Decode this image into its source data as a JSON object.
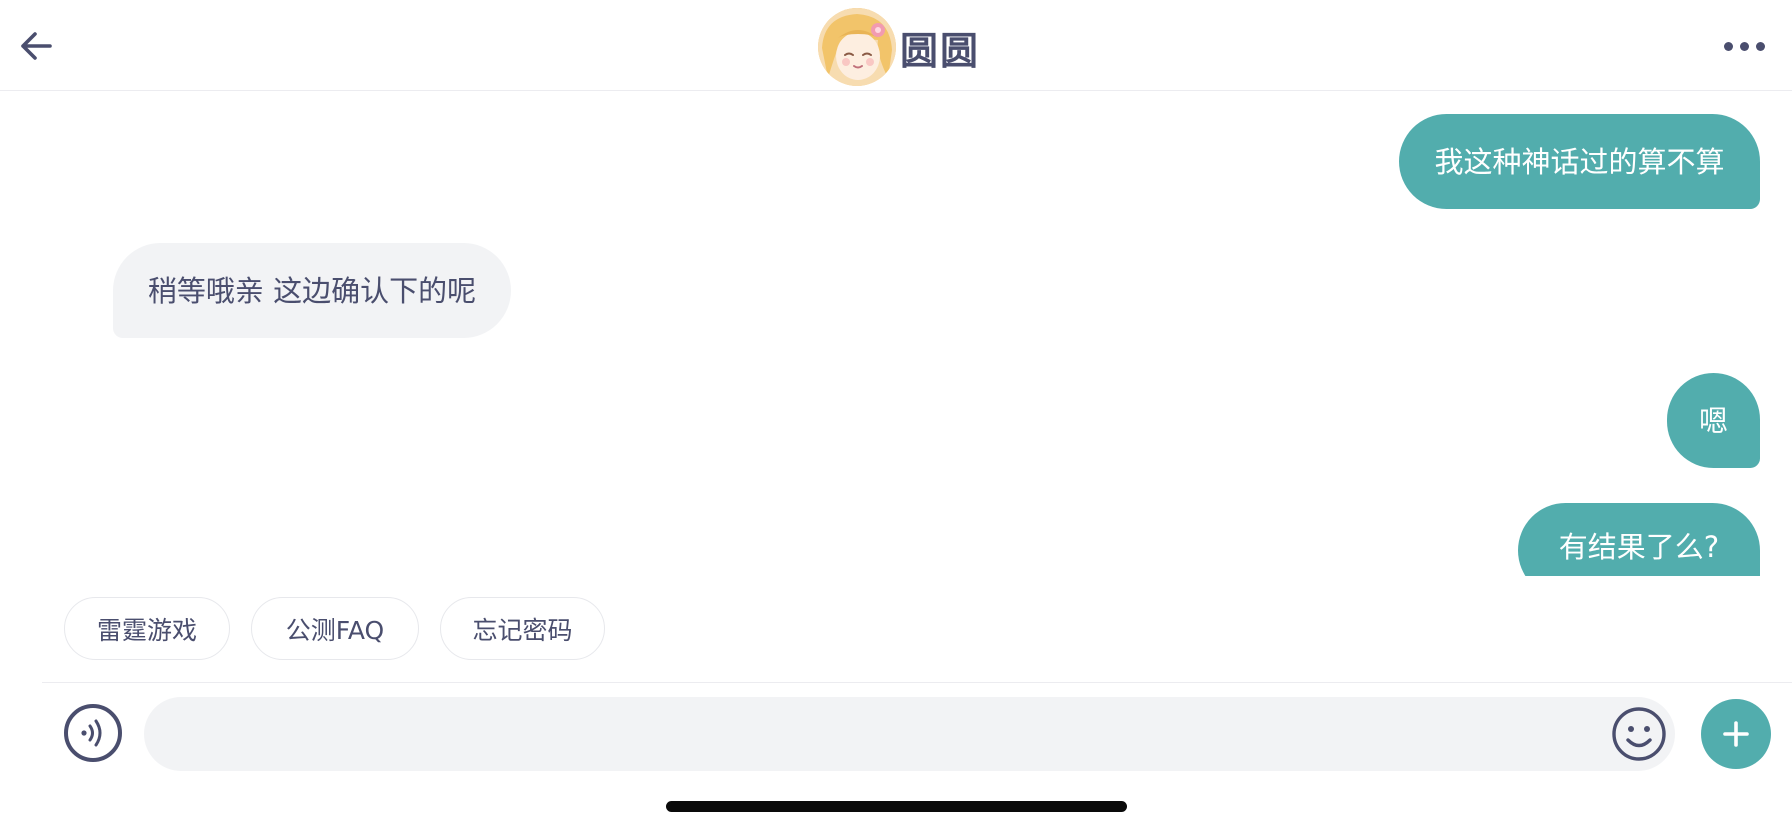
{
  "header": {
    "title": "圆圆",
    "back_icon": "arrow-left-icon",
    "more_icon": "more-horizontal-icon"
  },
  "messages": [
    {
      "direction": "out",
      "text": "我这种神话过的算不算"
    },
    {
      "direction": "in",
      "text": "稍等哦亲 这边确认下的呢"
    },
    {
      "direction": "out",
      "text": "嗯"
    },
    {
      "direction": "out",
      "text": "有结果了么?"
    }
  ],
  "quick_replies": [
    "雷霆游戏",
    "公测FAQ",
    "忘记密码"
  ],
  "input": {
    "value": "",
    "placeholder": "",
    "voice_icon": "voice-icon",
    "emoji_icon": "smiley-icon",
    "plus_icon": "plus-icon"
  },
  "colors": {
    "accent": "#52adad",
    "text": "#4a4e6e",
    "incoming_bubble": "#f2f3f5"
  }
}
